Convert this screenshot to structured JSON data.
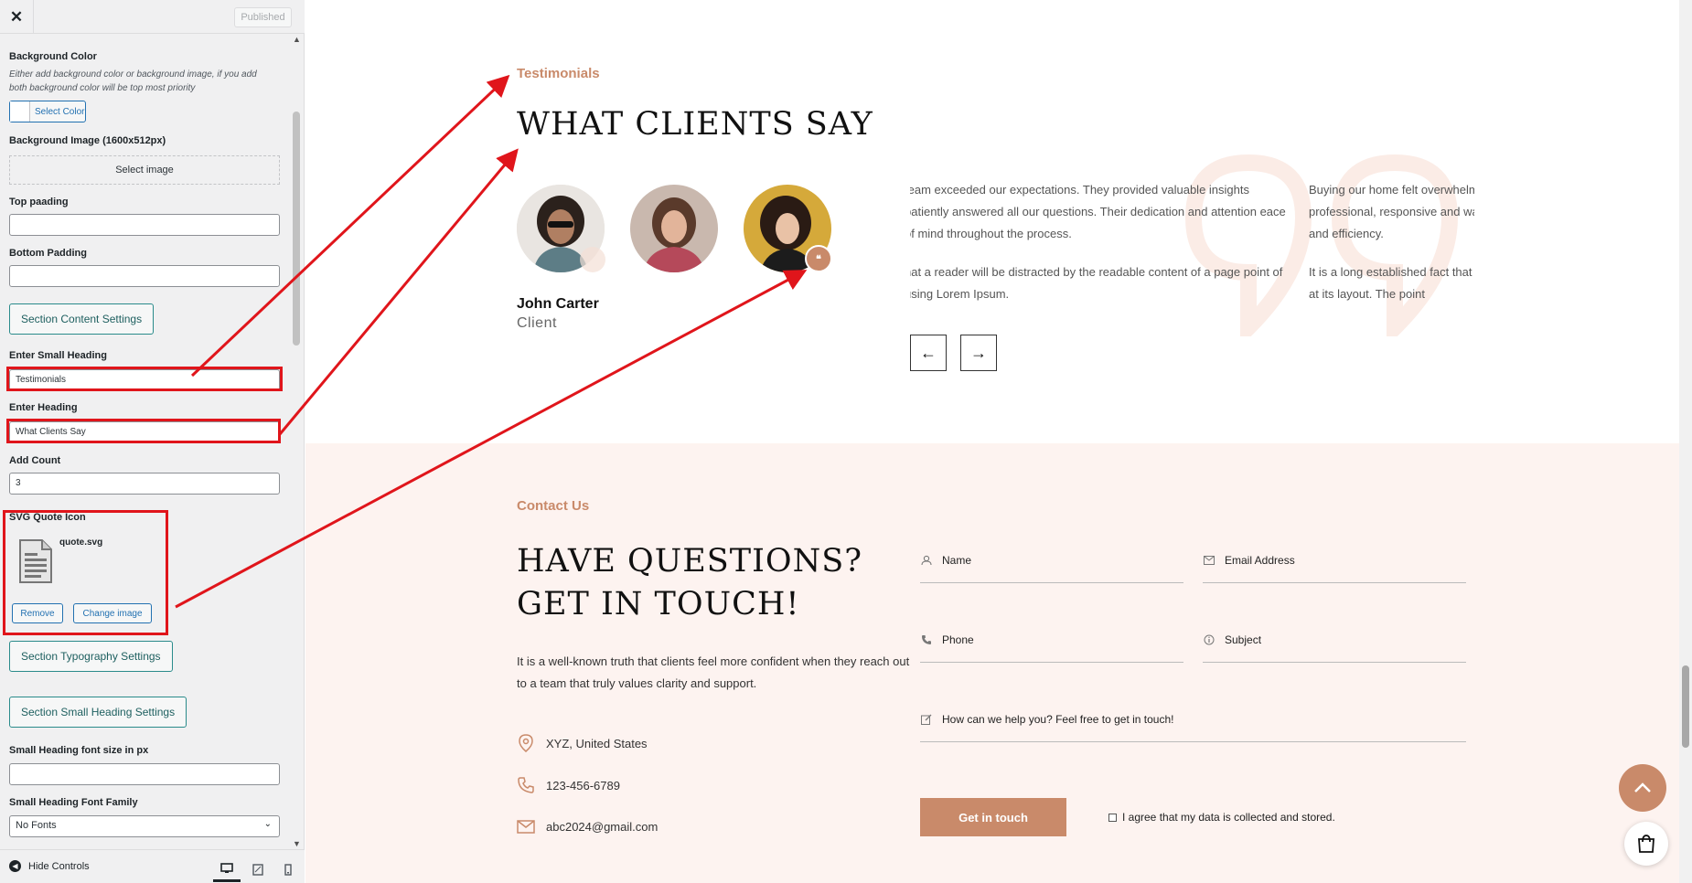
{
  "customizer": {
    "close_label": "✕",
    "published_label": "Published",
    "background_color": {
      "label": "Background Color",
      "description": "Either add background color or background image, if you add both background color will be top most priority",
      "button_label": "Select Color"
    },
    "background_image": {
      "label": "Background Image (1600x512px)",
      "button_label": "Select image"
    },
    "top_padding": {
      "label": "Top paading",
      "value": ""
    },
    "bottom_padding": {
      "label": "Bottom Padding",
      "value": ""
    },
    "section_content_settings": "Section Content Settings",
    "small_heading": {
      "label": "Enter Small Heading",
      "value": "Testimonials"
    },
    "heading": {
      "label": "Enter Heading",
      "value": "What Clients Say"
    },
    "add_count": {
      "label": "Add Count",
      "value": "3"
    },
    "svg_quote_icon": {
      "label": "SVG Quote Icon",
      "file_name": "quote.svg",
      "remove_label": "Remove",
      "change_label": "Change image"
    },
    "section_typography_settings": "Section Typography Settings",
    "section_small_heading_settings": "Section Small Heading Settings",
    "small_heading_font_size": {
      "label": "Small Heading font size in px",
      "value": ""
    },
    "small_heading_font_family": {
      "label": "Small Heading Font Family",
      "selected": "No Fonts"
    },
    "footer": {
      "hide_controls": "Hide Controls"
    }
  },
  "testimonials": {
    "small_heading": "Testimonials",
    "heading": "WHAT CLIENTS SAY",
    "active_name": "John Carter",
    "active_role": "Client",
    "column1": {
      "p1": "team exceeded our expectations. They provided valuable insights patiently answered all our questions. Their dedication and attention eace of mind throughout the process.",
      "p2": "nat a reader will be distracted by the readable content of a page point of using Lorem Ipsum."
    },
    "column2": {
      "p1": "Buying our home felt overwhelming, free.They were professional, responsive and was handled with care and efficiency.",
      "p2": "It is a long established fact that a reader when look at its layout. The point"
    },
    "prev_arrow": "←",
    "next_arrow": "→"
  },
  "contact": {
    "small_heading": "Contact Us",
    "heading_line1": "HAVE QUESTIONS?",
    "heading_line2": "GET IN TOUCH!",
    "description": "It is a well-known truth that clients feel more confident when they reach out to a team that truly values clarity and support.",
    "address": "XYZ, United States",
    "phone": "123-456-6789",
    "email": "abc2024@gmail.com",
    "form": {
      "name_placeholder": "Name",
      "email_placeholder": "Email Address",
      "phone_placeholder": "Phone",
      "subject_placeholder": "Subject",
      "message_placeholder": "How can we help you? Feel free to get in touch!",
      "submit_label": "Get in touch",
      "agree_label": "I agree that my data is collected and stored."
    }
  },
  "colors": {
    "accent": "#c98a6a",
    "annotation_red": "#e0151b",
    "contact_background": "#fdf3f0",
    "customizer_background": "#f0f0f1"
  }
}
